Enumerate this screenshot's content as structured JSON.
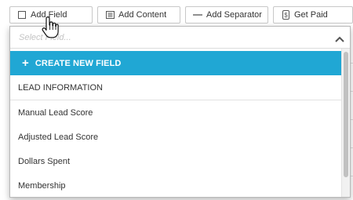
{
  "toolbar": {
    "add_field_label": "Add Field",
    "add_content_label": "Add Content",
    "add_separator_label": "Add Separator",
    "get_paid_label": "Get Paid"
  },
  "dropdown": {
    "search_placeholder": "Select Field...",
    "create_label": "CREATE NEW FIELD",
    "group_label": "LEAD INFORMATION",
    "options": [
      "Manual Lead Score",
      "Adjusted Lead Score",
      "Dollars Spent",
      "Membership"
    ]
  },
  "colors": {
    "accent": "#20a7d4",
    "border": "#c8c8c8",
    "text": "#333333"
  },
  "icons": [
    "checkbox-icon",
    "content-icon",
    "separator-icon",
    "dollar-icon",
    "chevron-up-icon",
    "hand-cursor-icon"
  ]
}
